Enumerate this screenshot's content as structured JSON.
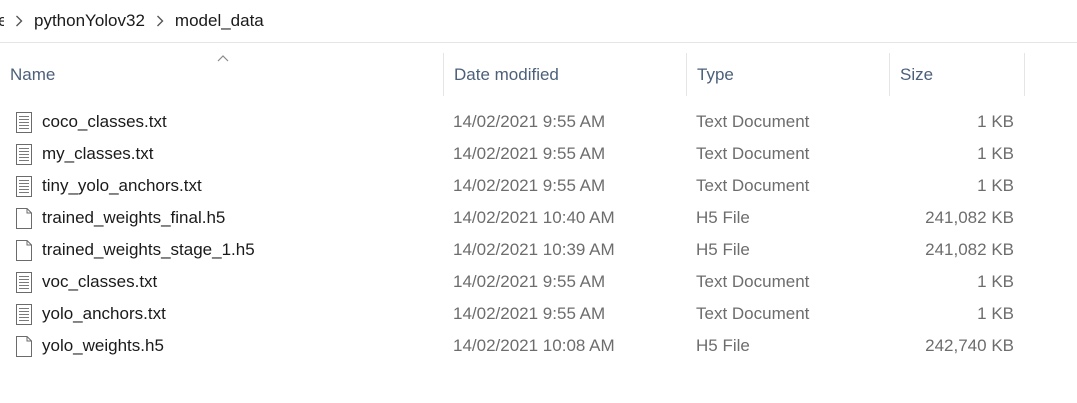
{
  "breadcrumb": {
    "items": [
      "e",
      "pythonYolov32",
      "model_data"
    ]
  },
  "columns": {
    "name": "Name",
    "date": "Date modified",
    "type": "Type",
    "size": "Size"
  },
  "files": [
    {
      "name": "coco_classes.txt",
      "date": "14/02/2021 9:55 AM",
      "type": "Text Document",
      "size": "1 KB",
      "icon": "text-document-icon"
    },
    {
      "name": "my_classes.txt",
      "date": "14/02/2021 9:55 AM",
      "type": "Text Document",
      "size": "1 KB",
      "icon": "text-document-icon"
    },
    {
      "name": "tiny_yolo_anchors.txt",
      "date": "14/02/2021 9:55 AM",
      "type": "Text Document",
      "size": "1 KB",
      "icon": "text-document-icon"
    },
    {
      "name": "trained_weights_final.h5",
      "date": "14/02/2021 10:40 AM",
      "type": "H5 File",
      "size": "241,082 KB",
      "icon": "blank-file-icon"
    },
    {
      "name": "trained_weights_stage_1.h5",
      "date": "14/02/2021 10:39 AM",
      "type": "H5 File",
      "size": "241,082 KB",
      "icon": "blank-file-icon"
    },
    {
      "name": "voc_classes.txt",
      "date": "14/02/2021 9:55 AM",
      "type": "Text Document",
      "size": "1 KB",
      "icon": "text-document-icon"
    },
    {
      "name": "yolo_anchors.txt",
      "date": "14/02/2021 9:55 AM",
      "type": "Text Document",
      "size": "1 KB",
      "icon": "text-document-icon"
    },
    {
      "name": "yolo_weights.h5",
      "date": "14/02/2021 10:08 AM",
      "type": "H5 File",
      "size": "242,740 KB",
      "icon": "blank-file-icon"
    }
  ]
}
